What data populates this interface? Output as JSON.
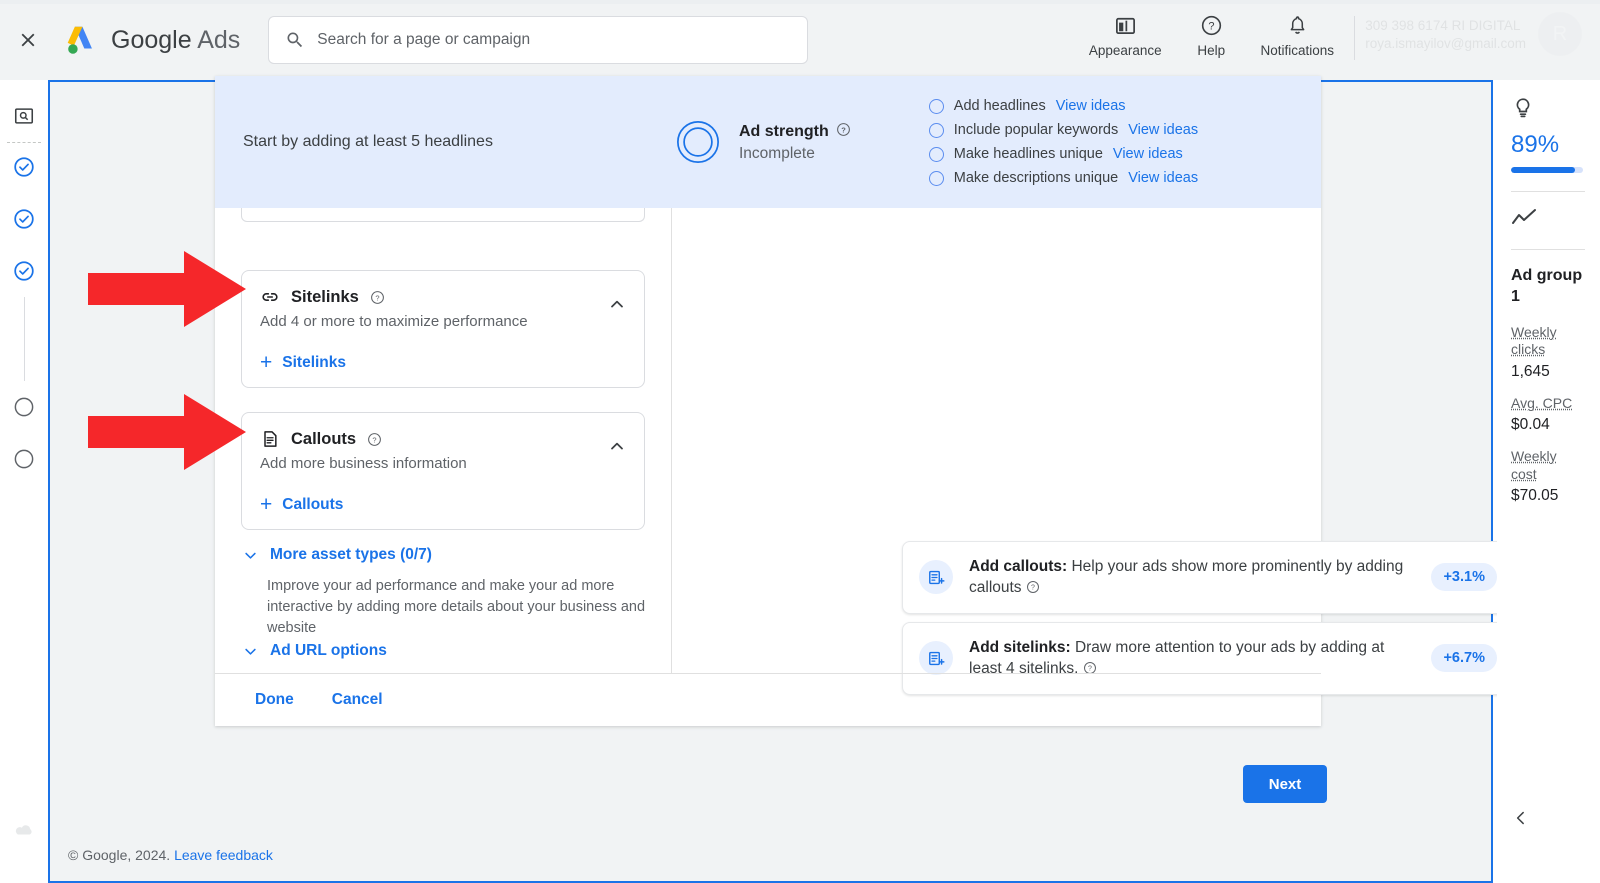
{
  "header": {
    "close_icon": "close-icon",
    "brand_primary": "Google",
    "brand_secondary": "Ads",
    "search": {
      "placeholder": "Search for a page or campaign",
      "value": "",
      "icon": "search-icon"
    },
    "actions": [
      {
        "label": "Appearance",
        "icon": "appearance-icon"
      },
      {
        "label": "Help",
        "icon": "help-circle-icon"
      },
      {
        "label": "Notifications",
        "icon": "bell-icon"
      }
    ],
    "account": {
      "line1": "309 398 6174 RI DIGITAL",
      "line2": "roya.ismayilov@gmail.com",
      "avatar_initial": "R"
    }
  },
  "left_rail": {
    "items": [
      {
        "name": "overview-search-icon",
        "state": "icon"
      },
      {
        "name": "step-complete-1",
        "state": "complete"
      },
      {
        "name": "step-complete-2",
        "state": "complete"
      },
      {
        "name": "step-complete-3",
        "state": "complete"
      },
      {
        "name": "step-pending-1",
        "state": "pending"
      },
      {
        "name": "step-pending-2",
        "state": "pending"
      }
    ],
    "cloud_icon": "cloud-icon"
  },
  "ad_strength": {
    "hint": "Start by adding at least 5 headlines",
    "title": "Ad strength",
    "status": "Incomplete",
    "help_icon": "help-icon",
    "checklist": [
      {
        "label": "Add headlines",
        "link": "View ideas",
        "checked": false
      },
      {
        "label": "Include popular keywords",
        "link": "View ideas",
        "checked": false
      },
      {
        "label": "Make headlines unique",
        "link": "View ideas",
        "checked": false
      },
      {
        "label": "Make descriptions unique",
        "link": "View ideas",
        "checked": false
      }
    ]
  },
  "asset_cards": [
    {
      "icon": "link-icon",
      "title": "Sitelinks",
      "subtitle": "Add 4 or more to maximize performance",
      "add_label": "Sitelinks",
      "collapse_icon": "chevron-up-icon"
    },
    {
      "icon": "document-icon",
      "title": "Callouts",
      "subtitle": "Add more business information",
      "add_label": "Callouts",
      "collapse_icon": "chevron-up-icon"
    }
  ],
  "expanders": {
    "more_assets_label": "More asset types (0/7)",
    "more_assets_desc": "Improve your ad performance and make your ad more interactive by adding more details about your business and website",
    "ad_url_label": "Ad URL options"
  },
  "recommendations": [
    {
      "title": "Add callouts:",
      "body": "Help your ads show more prominently by adding callouts",
      "badge": "+3.1%",
      "icon": "add-asset-icon",
      "help_icon": "help-icon"
    },
    {
      "title": "Add sitelinks:",
      "body": "Draw more attention to your ads by adding at least 4 sitelinks.",
      "badge": "+6.7%",
      "icon": "add-asset-icon",
      "help_icon": "help-icon"
    }
  ],
  "editor_footer": {
    "done_label": "Done",
    "cancel_label": "Cancel"
  },
  "next_button_label": "Next",
  "page_footer": {
    "copyright": "© Google, 2024.",
    "feedback_label": "Leave feedback"
  },
  "right_panel": {
    "bulb_icon": "lightbulb-icon",
    "percent": "89%",
    "percent_value": 89,
    "trend_icon": "trend-line-icon",
    "group_name": "Ad group 1",
    "metrics": [
      {
        "label": "Weekly clicks",
        "value": "1,645"
      },
      {
        "label": "Avg. CPC",
        "value": "$0.04"
      },
      {
        "label": "Weekly cost",
        "value": "$70.05"
      }
    ],
    "collapse_icon": "chevron-left-icon"
  },
  "annotations": {
    "arrow_color": "#f5272a",
    "arrows": [
      {
        "target": "sitelinks-card"
      },
      {
        "target": "callouts-card"
      }
    ]
  },
  "colors": {
    "accent_blue": "#1a73e8",
    "banner_bg": "#e3ecfd",
    "canvas_bg": "#f1f3f4",
    "badge_bg": "#e8f0fe"
  }
}
